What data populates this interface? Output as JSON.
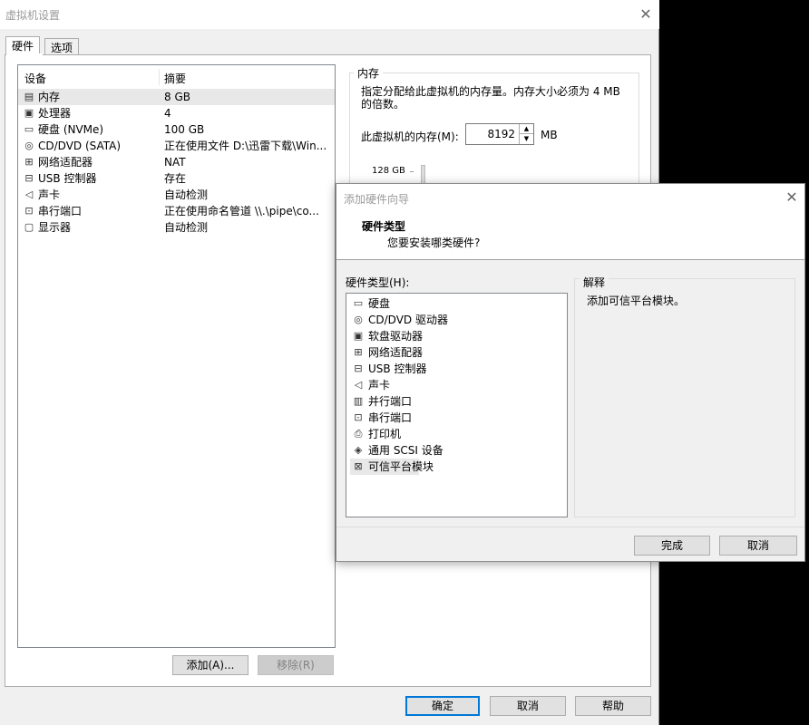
{
  "main_window": {
    "title": "虚拟机设置",
    "tabs": [
      {
        "label": "硬件"
      },
      {
        "label": "选项"
      }
    ],
    "device_list": {
      "col_device": "设备",
      "col_summary": "摘要",
      "rows": [
        {
          "name": "内存",
          "summary": "8 GB",
          "icon": "memory-icon"
        },
        {
          "name": "处理器",
          "summary": "4",
          "icon": "cpu-icon"
        },
        {
          "name": "硬盘 (NVMe)",
          "summary": "100 GB",
          "icon": "harddisk-icon"
        },
        {
          "name": "CD/DVD (SATA)",
          "summary": "正在使用文件 D:\\迅雷下载\\Win...",
          "icon": "cd-icon"
        },
        {
          "name": "网络适配器",
          "summary": "NAT",
          "icon": "network-icon"
        },
        {
          "name": "USB 控制器",
          "summary": "存在",
          "icon": "usb-icon"
        },
        {
          "name": "声卡",
          "summary": "自动检测",
          "icon": "speaker-icon"
        },
        {
          "name": "串行端口",
          "summary": "正在使用命名管道 \\\\.\\pipe\\co...",
          "icon": "serial-port-icon"
        },
        {
          "name": "显示器",
          "summary": "自动检测",
          "icon": "monitor-icon"
        }
      ]
    },
    "add_button": "添加(A)...",
    "remove_button": "移除(R)",
    "memory_group": {
      "title": "内存",
      "description": "指定分配给此虚拟机的内存量。内存大小必须为 4 MB 的倍数。",
      "field_label": "此虚拟机的内存(M):",
      "value": "8192",
      "unit": "MB",
      "slider_top_label": "128 GB"
    },
    "ok_button": "确定",
    "cancel_button": "取消",
    "help_button": "帮助"
  },
  "wizard": {
    "title": "添加硬件向导",
    "heading": "硬件类型",
    "subheading": "您要安装哪类硬件?",
    "list_label": "硬件类型(H):",
    "items": [
      {
        "label": "硬盘",
        "icon": "harddisk-icon"
      },
      {
        "label": "CD/DVD 驱动器",
        "icon": "cd-icon"
      },
      {
        "label": "软盘驱动器",
        "icon": "floppy-icon"
      },
      {
        "label": "网络适配器",
        "icon": "network-icon"
      },
      {
        "label": "USB 控制器",
        "icon": "usb-icon"
      },
      {
        "label": "声卡",
        "icon": "speaker-icon"
      },
      {
        "label": "并行端口",
        "icon": "parallel-port-icon"
      },
      {
        "label": "串行端口",
        "icon": "serial-port-icon"
      },
      {
        "label": "打印机",
        "icon": "printer-icon"
      },
      {
        "label": "通用 SCSI 设备",
        "icon": "scsi-icon"
      },
      {
        "label": "可信平台模块",
        "icon": "tpm-icon"
      }
    ],
    "explain_label": "解释",
    "explain_text": "添加可信平台模块。",
    "finish_button": "完成",
    "cancel_button": "取消"
  }
}
